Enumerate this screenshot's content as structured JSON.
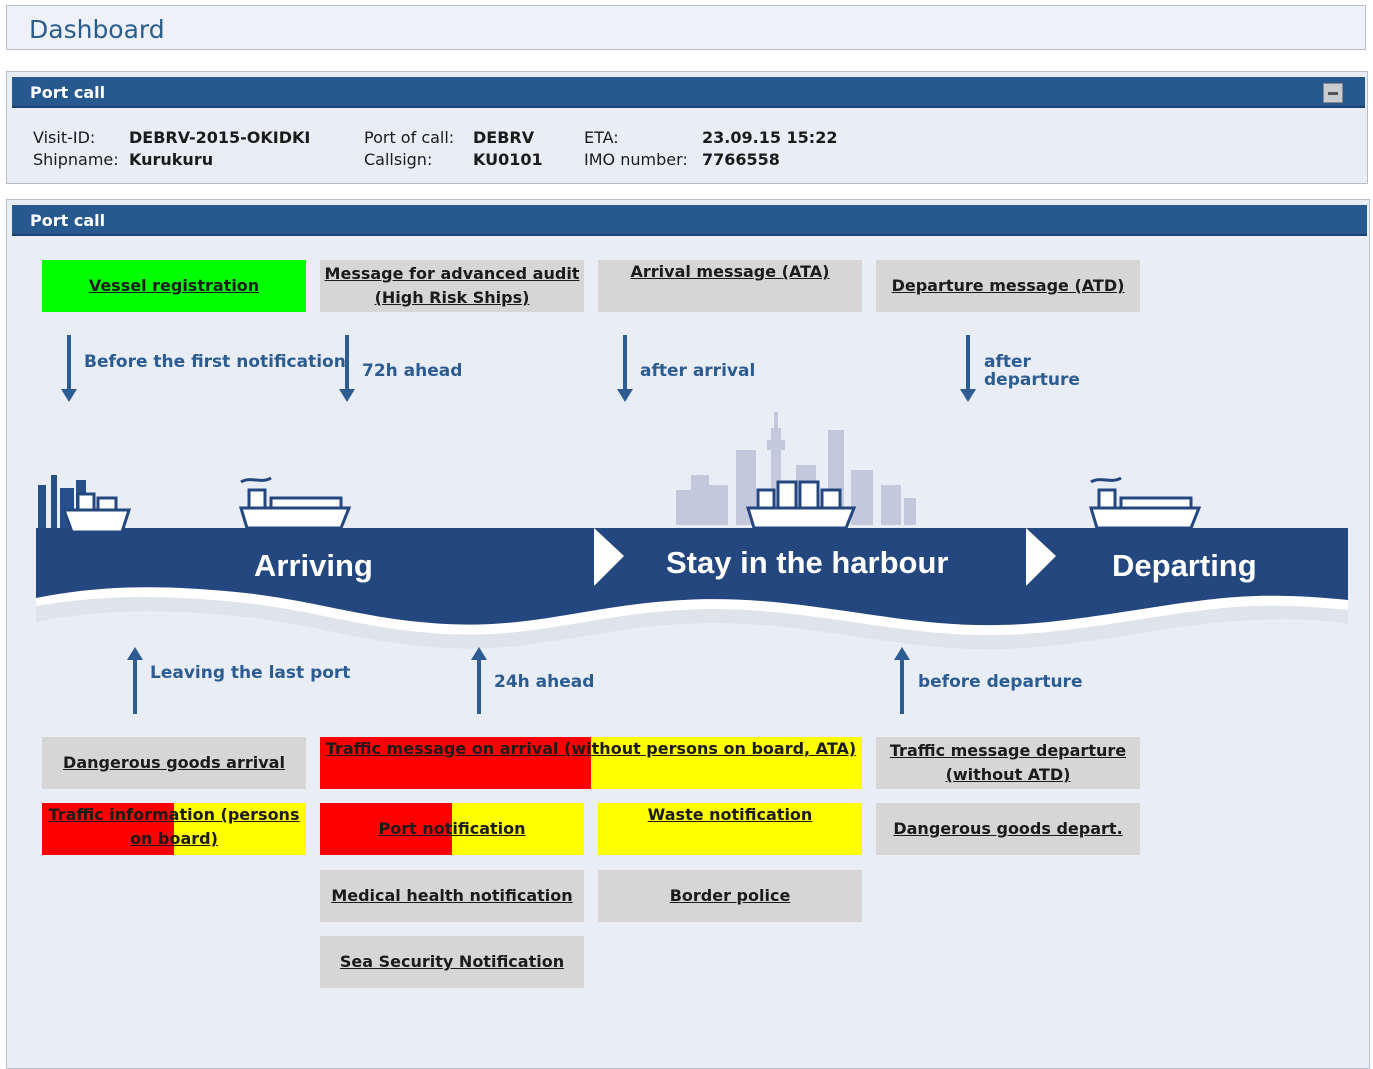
{
  "dashboard": {
    "title": "Dashboard"
  },
  "portcall_info": {
    "header": "Port call",
    "visit_id_label": "Visit-ID:",
    "visit_id": "DEBRV-2015-OKIDKI",
    "shipname_label": "Shipname:",
    "shipname": "Kurukuru",
    "port_label": "Port of call:",
    "port": "DEBRV",
    "callsign_label": "Callsign:",
    "callsign": "KU0101",
    "eta_label": "ETA:",
    "eta": "23.09.15 15:22",
    "imo_label": "IMO number:",
    "imo": "7766558"
  },
  "process": {
    "header": "Port call",
    "top_tiles": {
      "vessel_registration": "Vessel registration",
      "advanced_audit": "Message for advanced audit (High Risk Ships)",
      "arrival_message": "Arrival message (ATA)",
      "departure_message": "Departure message (ATD)"
    },
    "top_arrows": {
      "first": "Before the first notification",
      "second": "72h ahead",
      "third": "after arrival",
      "fourth": "after departure"
    },
    "banner": {
      "arriving": "Arriving",
      "stay": "Stay in the harbour",
      "departing": "Departing"
    },
    "bottom_arrows": {
      "first": "Leaving the last port",
      "second": "24h ahead",
      "third": "before departure"
    },
    "bottom_tiles": {
      "dangerous_arrival": "Dangerous goods arrival",
      "traffic_arrival": "Traffic message on arrival (without persons on board, ATA)",
      "traffic_departure": "Traffic message departure (without ATD)",
      "traffic_info": "Traffic information (persons on board)",
      "port_notification": "Port notification",
      "waste_notification": "Waste notification",
      "dangerous_depart": "Dangerous goods depart.",
      "medical": "Medical health notification",
      "border_police": "Border police",
      "sea_security": "Sea Security Notification"
    },
    "status_colors": {
      "complete": "#00ff00",
      "error": "#ff0000",
      "pending": "#ffff00",
      "inactive": "#d6d6d6"
    },
    "progress": {
      "traffic_arrival": 0.5,
      "traffic_info": 0.5,
      "port_notification": 0.5
    }
  }
}
